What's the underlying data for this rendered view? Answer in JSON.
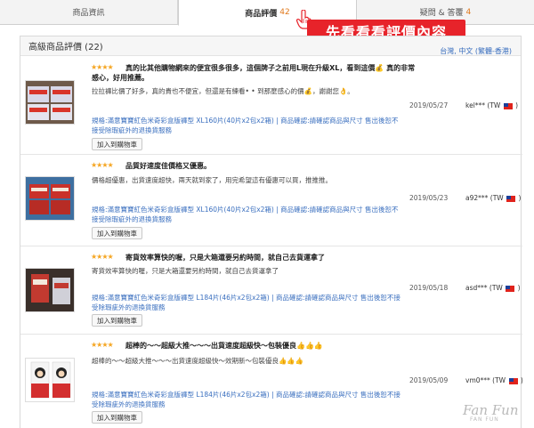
{
  "tabs": [
    {
      "label": "商品資訊",
      "count": ""
    },
    {
      "label": "商品評價",
      "count": "42"
    },
    {
      "label": "疑問 & 答覆",
      "count": "4"
    }
  ],
  "callout": "先看看看評價內容",
  "panel": {
    "title": "高級商品評價 (22)",
    "language": "台灣, 中文 (繁體-香港)"
  },
  "reviews": [
    {
      "stars": "★★★★",
      "title": "真的比其他購物網來的便宜很多很多，這個牌子之前用L現在升級XL，看到這價💰 真的非常",
      "title2": "感心，好用推薦。",
      "body": "拉拉褲比價了好多，真的貴也不便宜，但還是有練看• • 到那麼感心的價💰，謝謝您👌。",
      "spec": "規格:滿意寶寶紅色米奇彩盒版褲型 XL160片(40片x2包x2箱) | 商品確認:請確認商品與尺寸 售出後恕不接受除瑕疵外的退換貨服務",
      "button": "加入到購物車",
      "date": "2019/05/27",
      "user": "kel***",
      "country": "(TW",
      "close": ")"
    },
    {
      "stars": "★★★★",
      "title": "品質好速度佳價格又優惠。",
      "title2": "",
      "body": "價格超優惠，出貨速度超快，兩天就到家了，用完希望這有優惠可以買，推推推。",
      "spec": "規格:滿意寶寶紅色米奇彩盒版褲型 XL160片(40片x2包x2箱) | 商品確認:請確認商品與尺寸 售出後恕不接受除瑕疵外的退換貨服務",
      "button": "加入到購物車",
      "date": "2019/05/23",
      "user": "a92***",
      "country": "(TW",
      "close": ")"
    },
    {
      "stars": "★★★★",
      "title": "寄貨效率算快的喔，只是大箱還要另約時間，就自己去貨運拿了",
      "title2": "",
      "body": "寄貨效率算快的喔，只是大箱還要另約時間，就自己去貨運拿了",
      "spec": "規格:滿意寶寶紅色米奇彩盒版褲型 L184片(46片x2包x2箱) | 商品確認:請確認商品與尺寸 售出後恕不接受除瑕疵外的退換貨服務",
      "button": "加入到購物車",
      "date": "2019/05/18",
      "user": "asd***",
      "country": "(TW",
      "close": ")"
    },
    {
      "stars": "★★★★",
      "title": "超棒的～～超級大推～～～出貨速度超級快～包裝優良👍👍👍",
      "title2": "",
      "body": "超棒的～～超級大推～～～出貨速度超級快～效期新～包裝優良👍👍👍",
      "spec": "規格:滿意寶寶紅色米奇彩盒版褲型 L184片(46片x2包x2箱) | 商品確認:請確認商品與尺寸 售出後恕不接受除瑕疵外的退換貨服務",
      "button": "加入到購物車",
      "date": "2019/05/09",
      "user": "vm0***",
      "country": "(TW",
      "close": ")"
    }
  ],
  "watermark": {
    "title": "Fan Fun",
    "sub": "FAN FUN"
  }
}
